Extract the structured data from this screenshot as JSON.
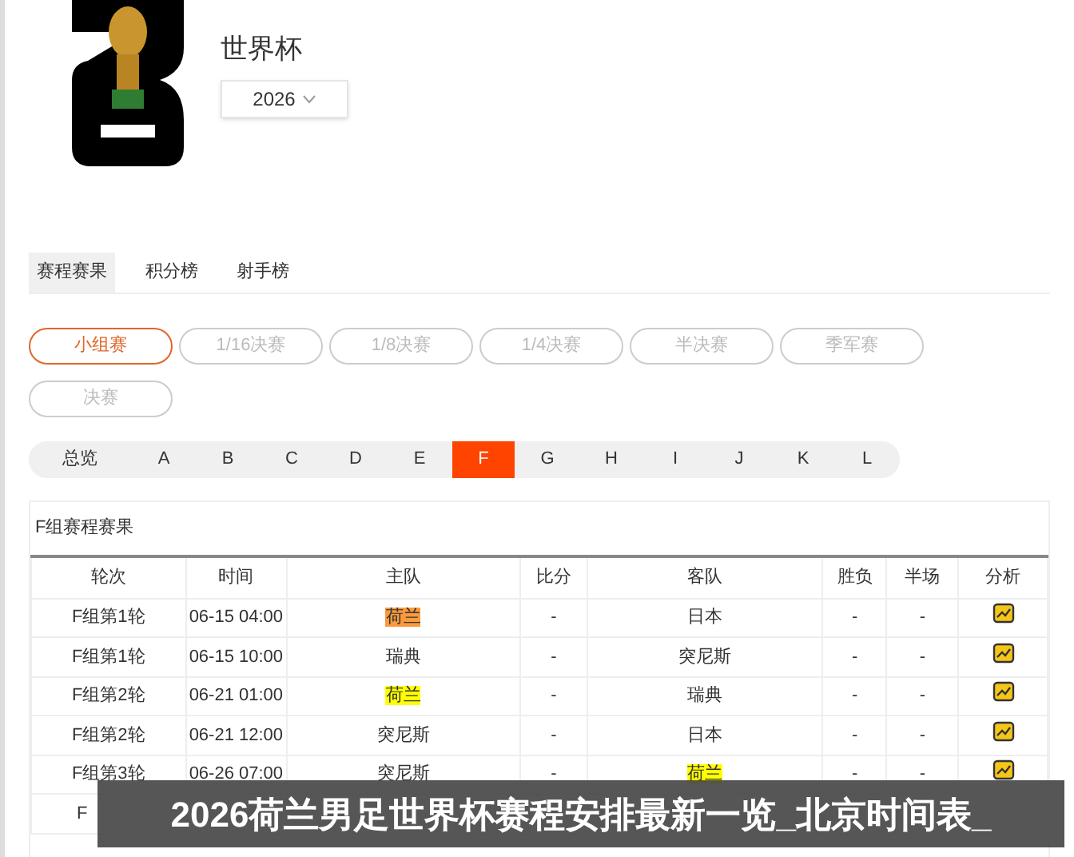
{
  "header": {
    "title": "世界杯",
    "year_select": {
      "value": "2026"
    }
  },
  "tabs": [
    {
      "label": "赛程赛果",
      "selected": true
    },
    {
      "label": "积分榜",
      "selected": false
    },
    {
      "label": "射手榜",
      "selected": false
    }
  ],
  "stages": [
    {
      "label": "小组赛",
      "selected": true
    },
    {
      "label": "1/16决赛",
      "selected": false
    },
    {
      "label": "1/8决赛",
      "selected": false
    },
    {
      "label": "1/4决赛",
      "selected": false
    },
    {
      "label": "半决赛",
      "selected": false
    },
    {
      "label": "季军赛",
      "selected": false
    },
    {
      "label": "决赛",
      "selected": false
    }
  ],
  "groups": [
    {
      "label": "总览",
      "selected": false
    },
    {
      "label": "A",
      "selected": false
    },
    {
      "label": "B",
      "selected": false
    },
    {
      "label": "C",
      "selected": false
    },
    {
      "label": "D",
      "selected": false
    },
    {
      "label": "E",
      "selected": false
    },
    {
      "label": "F",
      "selected": true
    },
    {
      "label": "G",
      "selected": false
    },
    {
      "label": "H",
      "selected": false
    },
    {
      "label": "I",
      "selected": false
    },
    {
      "label": "J",
      "selected": false
    },
    {
      "label": "K",
      "selected": false
    },
    {
      "label": "L",
      "selected": false
    }
  ],
  "table": {
    "title": "F组赛程赛果",
    "columns": [
      "轮次",
      "时间",
      "主队",
      "比分",
      "客队",
      "胜负",
      "半场",
      "分析"
    ],
    "rows": [
      {
        "round": "F组第1轮",
        "time": "06-15 04:00",
        "home": {
          "name": "荷兰",
          "color": "#fa9a3c"
        },
        "score": "-",
        "away": {
          "name": "日本"
        },
        "result": "-",
        "half": "-"
      },
      {
        "round": "F组第1轮",
        "time": "06-15 10:00",
        "home": {
          "name": "瑞典"
        },
        "score": "-",
        "away": {
          "name": "突尼斯"
        },
        "result": "-",
        "half": "-"
      },
      {
        "round": "F组第2轮",
        "time": "06-21 01:00",
        "home": {
          "name": "荷兰",
          "color": "#ffff00"
        },
        "score": "-",
        "away": {
          "name": "瑞典"
        },
        "result": "-",
        "half": "-"
      },
      {
        "round": "F组第2轮",
        "time": "06-21 12:00",
        "home": {
          "name": "突尼斯"
        },
        "score": "-",
        "away": {
          "name": "日本"
        },
        "result": "-",
        "half": "-"
      },
      {
        "round": "F组第3轮",
        "time": "06-26 07:00",
        "home": {
          "name": "突尼斯"
        },
        "score": "-",
        "away": {
          "name": "荷兰",
          "color": "#ffff00"
        },
        "result": "-",
        "half": "-"
      },
      {
        "round": "F"
      }
    ]
  },
  "caption_banner": "2026荷兰男足世界杯赛程安排最新一览_北京时间表_"
}
